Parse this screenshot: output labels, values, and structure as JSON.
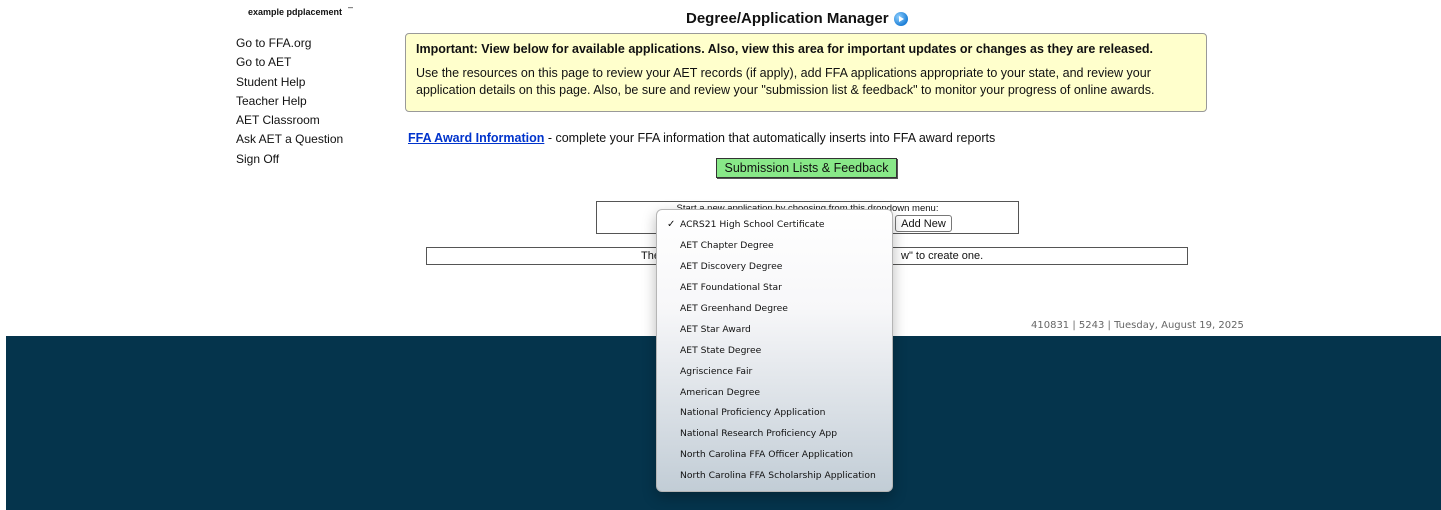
{
  "user": {
    "name": "example pdplacement",
    "dash": "–"
  },
  "nav": [
    "Go to FFA.org",
    "Go to AET",
    "Student Help",
    "Teacher Help",
    "AET Classroom",
    "Ask AET a Question",
    "Sign Off"
  ],
  "page": {
    "title": "Degree/Application Manager",
    "title_icon": "play-icon"
  },
  "notice": {
    "heading": "Important: View below for available applications. Also, view this area for important updates or changes as they are released.",
    "body": "Use the resources on this page to review your AET records (if apply), add FFA applications appropriate to your state, and review your application details on this page. Also, be sure and review your \"submission list & feedback\" to monitor your progress of online awards."
  },
  "ffa_info": {
    "link": "FFA Award Information",
    "text": " - complete your FFA information that automatically inserts into FFA award reports"
  },
  "submission_button": "Submission Lists & Feedback",
  "new_app": {
    "label": "Start a new application by choosing from this dropdown menu:",
    "add_button": "Add New",
    "selected": "ACRS21 High School Certificate"
  },
  "empty_message": {
    "left": "The",
    "right": "w\" to create one."
  },
  "footer": {
    "info": "410831 | 5243 | Tuesday, August 19, 2025",
    "band_color": "#05344c"
  },
  "dropdown_options": [
    "ACRS21 High School Certificate",
    "AET Chapter Degree",
    "AET Discovery Degree",
    "AET Foundational Star",
    "AET Greenhand Degree",
    "AET Star Award",
    "AET State Degree",
    "Agriscience Fair",
    "American Degree",
    "National Proficiency Application",
    "National Research Proficiency App",
    "North Carolina FFA Officer Application",
    "North Carolina FFA Scholarship Application"
  ],
  "check_mark": "✓"
}
